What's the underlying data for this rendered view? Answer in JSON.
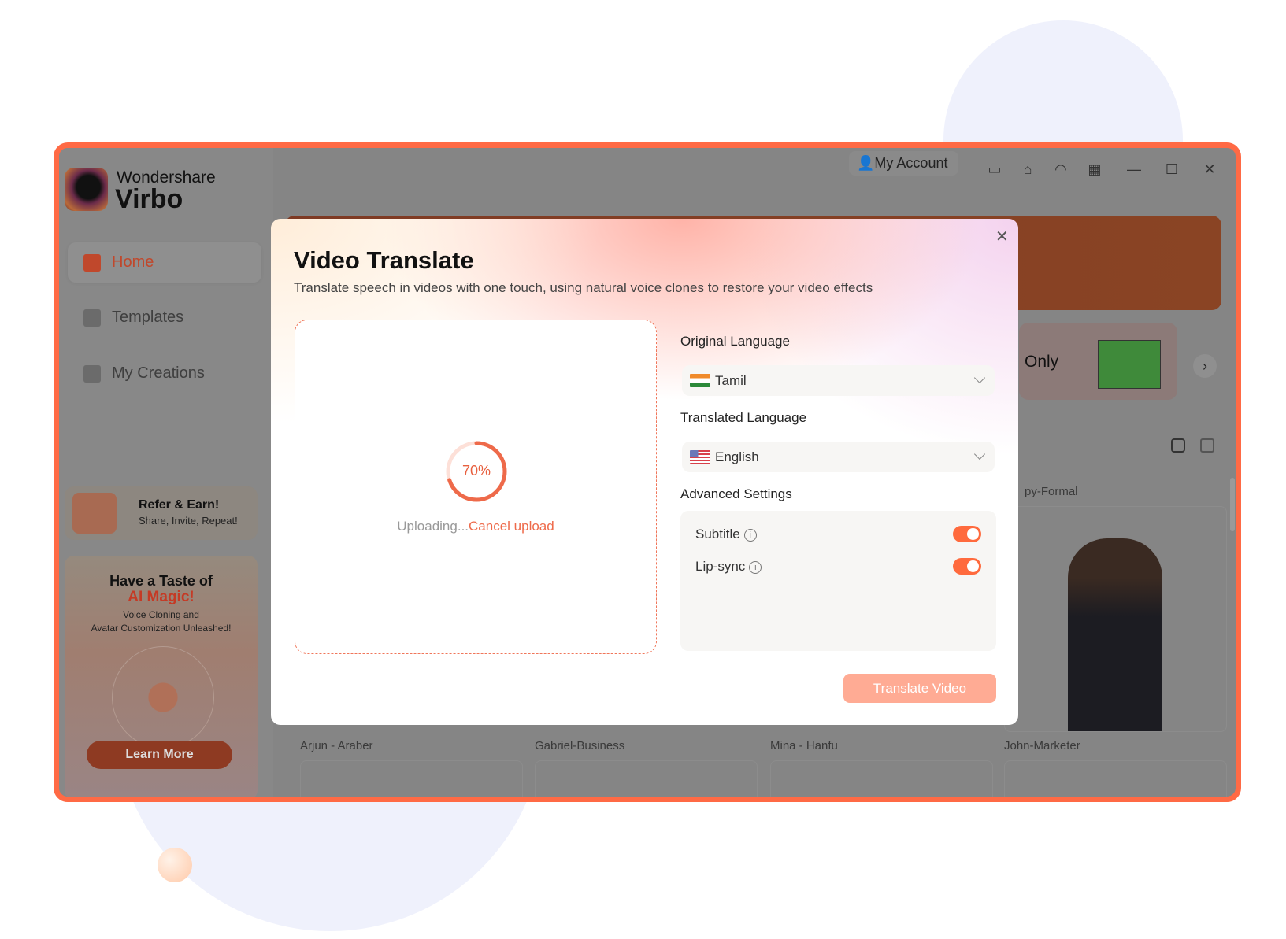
{
  "colors": {
    "accent": "#ff6a45",
    "button_disabled": "#ffab94",
    "progress": "#ee6a4a"
  },
  "sidebar": {
    "brand_top": "Wondershare",
    "brand_name": "Virbo",
    "items": [
      {
        "label": "Home",
        "icon": "home-icon",
        "active": true
      },
      {
        "label": "Templates",
        "icon": "templates-icon"
      },
      {
        "label": "My Creations",
        "icon": "creations-icon"
      }
    ],
    "refer": {
      "title": "Refer & Earn!",
      "subtitle": "Share, Invite, Repeat!"
    },
    "promo": {
      "title_line1": "Have a Taste of",
      "title_line2": "AI Magic!",
      "desc_line1": "Voice Cloning and",
      "desc_line2": "Avatar Customization Unleashed!",
      "button": "Learn More"
    }
  },
  "topbar": {
    "account": "My Account",
    "icons": [
      "feedback-icon",
      "tutorial-icon",
      "support-icon",
      "apps-icon",
      "minimize-icon",
      "maximize-icon",
      "close-icon"
    ]
  },
  "background": {
    "feature_card_text": "Only",
    "partial_label": "py-Formal",
    "avatars": [
      "Arjun - Araber",
      "Gabriel-Business",
      "Mina - Hanfu",
      "John-Marketer"
    ]
  },
  "modal": {
    "title": "Video Translate",
    "subtitle": "Translate speech in videos with one touch, using natural voice clones to restore your video effects",
    "upload": {
      "progress_percent": 70,
      "progress_label": "70%",
      "status": "Uploading...",
      "cancel": "Cancel upload"
    },
    "original_language": {
      "label": "Original Language",
      "value": "Tamil",
      "flag": "india-flag"
    },
    "translated_language": {
      "label": "Translated Language",
      "value": "English",
      "flag": "us-flag"
    },
    "advanced": {
      "label": "Advanced Settings",
      "options": [
        {
          "label": "Subtitle",
          "on": true
        },
        {
          "label": "Lip-sync",
          "on": true
        }
      ]
    },
    "submit": "Translate Video"
  }
}
